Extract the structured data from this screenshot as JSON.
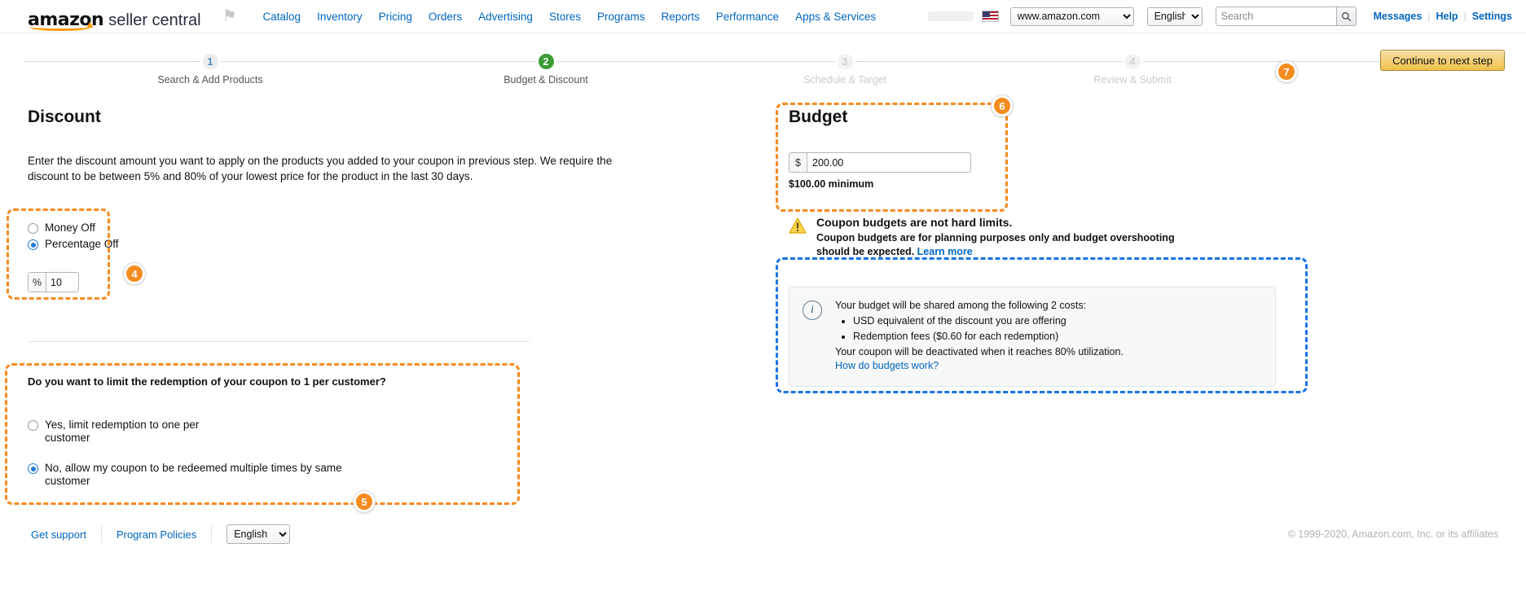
{
  "nav": {
    "brand_amazon": "amazon",
    "brand_seller_central": "seller central",
    "flag_icon": "flag-icon",
    "links": [
      "Catalog",
      "Inventory",
      "Pricing",
      "Orders",
      "Advertising",
      "Stores",
      "Programs",
      "Reports",
      "Performance",
      "Apps & Services"
    ],
    "marketplace_selected": "www.amazon.com",
    "language_selected": "English",
    "search_placeholder": "Search",
    "search_value": "",
    "search_icon": "search-icon",
    "messages": "Messages",
    "help": "Help",
    "settings": "Settings",
    "divider": "|"
  },
  "wizard": {
    "steps": [
      {
        "num": "1",
        "label": "Search & Add Products",
        "state": "pending"
      },
      {
        "num": "2",
        "label": "Budget & Discount",
        "state": "done"
      },
      {
        "num": "3",
        "label": "Schedule & Target",
        "state": "future"
      },
      {
        "num": "4",
        "label": "Review & Submit",
        "state": "future"
      }
    ],
    "continue_label": "Continue to next step"
  },
  "annotations": {
    "b4": "4",
    "b5": "5",
    "b6": "6",
    "b7": "7"
  },
  "discount": {
    "title": "Discount",
    "intro": "Enter the discount amount you want to apply on the products you added to your coupon in previous step. We require the discount to be between 5% and 80% of your lowest price for the product in the last 30 days.",
    "type_options": [
      {
        "label": "Money Off",
        "selected": false
      },
      {
        "label": "Percentage Off",
        "selected": true
      }
    ],
    "percent_prefix": "%",
    "percent_value": "10"
  },
  "redemption": {
    "question": "Do you want to limit the redemption of your coupon to 1 per customer?",
    "options": [
      {
        "label": "Yes, limit redemption to one per customer",
        "selected": false
      },
      {
        "label": "No, allow my coupon to be redeemed multiple times by same customer",
        "selected": true
      }
    ]
  },
  "budget": {
    "title": "Budget",
    "currency_prefix": "$",
    "amount_value": "200.00",
    "minimum_note": "$100.00 minimum",
    "warning_icon": "warning-triangle-icon",
    "warning_title": "Coupon budgets are not hard limits.",
    "warning_body": "Coupon budgets are for planning purposes only and budget overshooting should be expected.",
    "warning_link": "Learn more",
    "info_icon": "info-circle-icon",
    "info_lead": "Your budget will be shared among the following 2 costs:",
    "info_bullets": [
      "USD equivalent of the discount you are offering",
      "Redemption fees ($0.60 for each redemption)"
    ],
    "info_trail": "Your coupon will be deactivated when it reaches 80% utilization.",
    "info_link": "How do budgets work?"
  },
  "footer": {
    "get_support": "Get support",
    "program_policies": "Program Policies",
    "language_selected": "English",
    "copyright": "© 1999-2020, Amazon.com, Inc. or its affiliates"
  },
  "colors": {
    "accent_orange": "#f68b1f",
    "annotation_blue": "#1a73e8",
    "link_blue": "#0066c0",
    "step_done_green": "#3d9b35",
    "button_gold": "#f0c14b"
  }
}
